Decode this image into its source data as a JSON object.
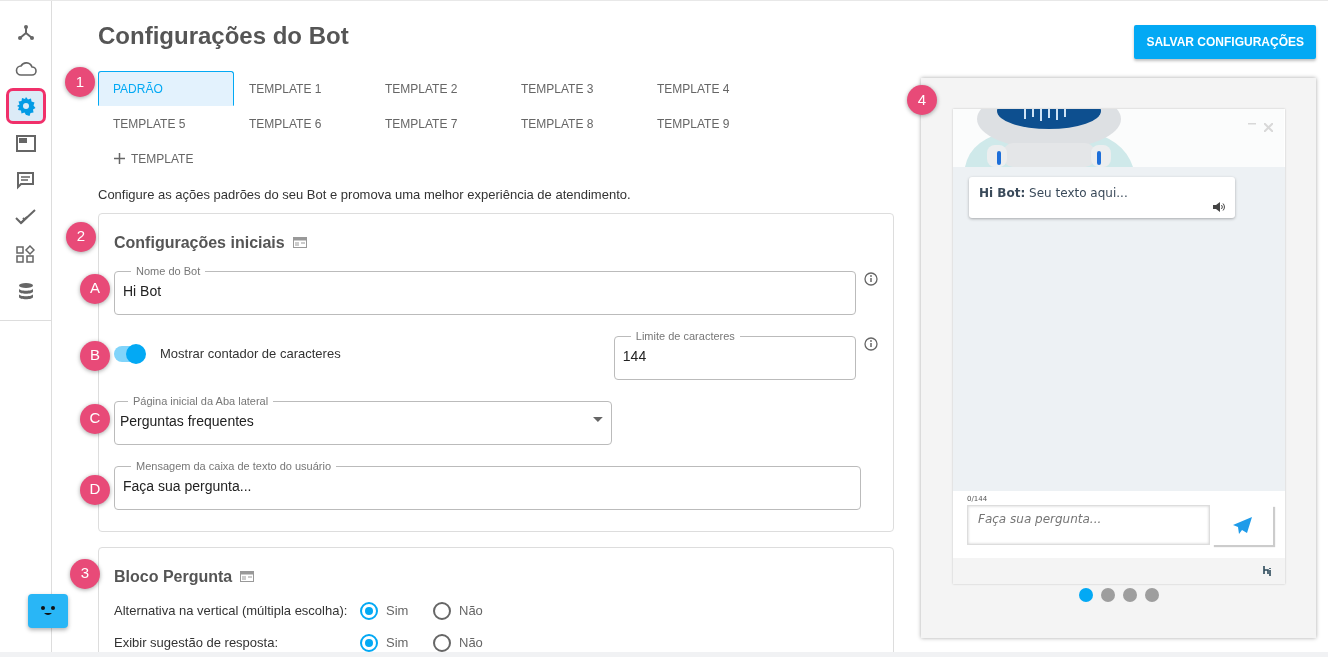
{
  "sidebar": {
    "items": [
      {
        "kind": "network",
        "selected": false
      },
      {
        "kind": "cloud",
        "selected": false
      },
      {
        "kind": "settings",
        "selected": true
      },
      {
        "kind": "window",
        "selected": false
      },
      {
        "kind": "chat",
        "selected": false
      },
      {
        "kind": "check",
        "selected": false
      },
      {
        "kind": "widgets",
        "selected": false
      },
      {
        "kind": "database",
        "selected": false
      }
    ]
  },
  "title": "Configurações do Bot",
  "save_button": "SALVAR CONFIGURAÇÕES",
  "tabs_marker": "1",
  "tabs": [
    {
      "label": "PADRÃO",
      "selected": true
    },
    {
      "label": "TEMPLATE 1",
      "selected": false
    },
    {
      "label": "TEMPLATE 2",
      "selected": false
    },
    {
      "label": "TEMPLATE 3",
      "selected": false
    },
    {
      "label": "TEMPLATE 4",
      "selected": false
    },
    {
      "label": "TEMPLATE 5",
      "selected": false
    },
    {
      "label": "TEMPLATE 6",
      "selected": false
    },
    {
      "label": "TEMPLATE 7",
      "selected": false
    },
    {
      "label": "TEMPLATE 8",
      "selected": false
    },
    {
      "label": "TEMPLATE 9",
      "selected": false
    }
  ],
  "add_tab": "TEMPLATE",
  "description": "Configure as ações padrões do seu Bot e promova uma melhor experiência de atendimento.",
  "initial_settings": {
    "marker": "2",
    "title": "Configurações iniciais",
    "bot_name": {
      "marker": "A",
      "label": "Nome do Bot",
      "value": "Hi Bot"
    },
    "counter": {
      "marker": "B",
      "label": "Mostrar contador de caracteres",
      "on": true,
      "limit_label": "Limite de caracteres",
      "limit_value": "144"
    },
    "sidebar_page": {
      "marker": "C",
      "label": "Página inicial da Aba lateral",
      "value": "Perguntas frequentes"
    },
    "user_message": {
      "marker": "D",
      "label": "Mensagem da caixa de texto do usuário",
      "value": "Faça sua pergunta..."
    }
  },
  "question_block": {
    "marker": "3",
    "title": "Bloco Pergunta",
    "rows": [
      {
        "label": "Alternativa na vertical (múltipla escolha):",
        "options": [
          {
            "label": "Sim",
            "selected": true
          },
          {
            "label": "Não",
            "selected": false
          }
        ]
      },
      {
        "label": "Exibir sugestão de resposta:",
        "options": [
          {
            "label": "Sim",
            "selected": true
          },
          {
            "label": "Não",
            "selected": false
          }
        ]
      }
    ]
  },
  "preview": {
    "marker": "4",
    "bot_message": {
      "sender": "Hi Bot:",
      "text": "Seu texto aqui..."
    },
    "counter": "0/144",
    "input_placeholder": "Faça sua pergunta...",
    "pages": [
      {
        "selected": true
      },
      {
        "selected": false
      },
      {
        "selected": false
      },
      {
        "selected": false
      }
    ]
  }
}
